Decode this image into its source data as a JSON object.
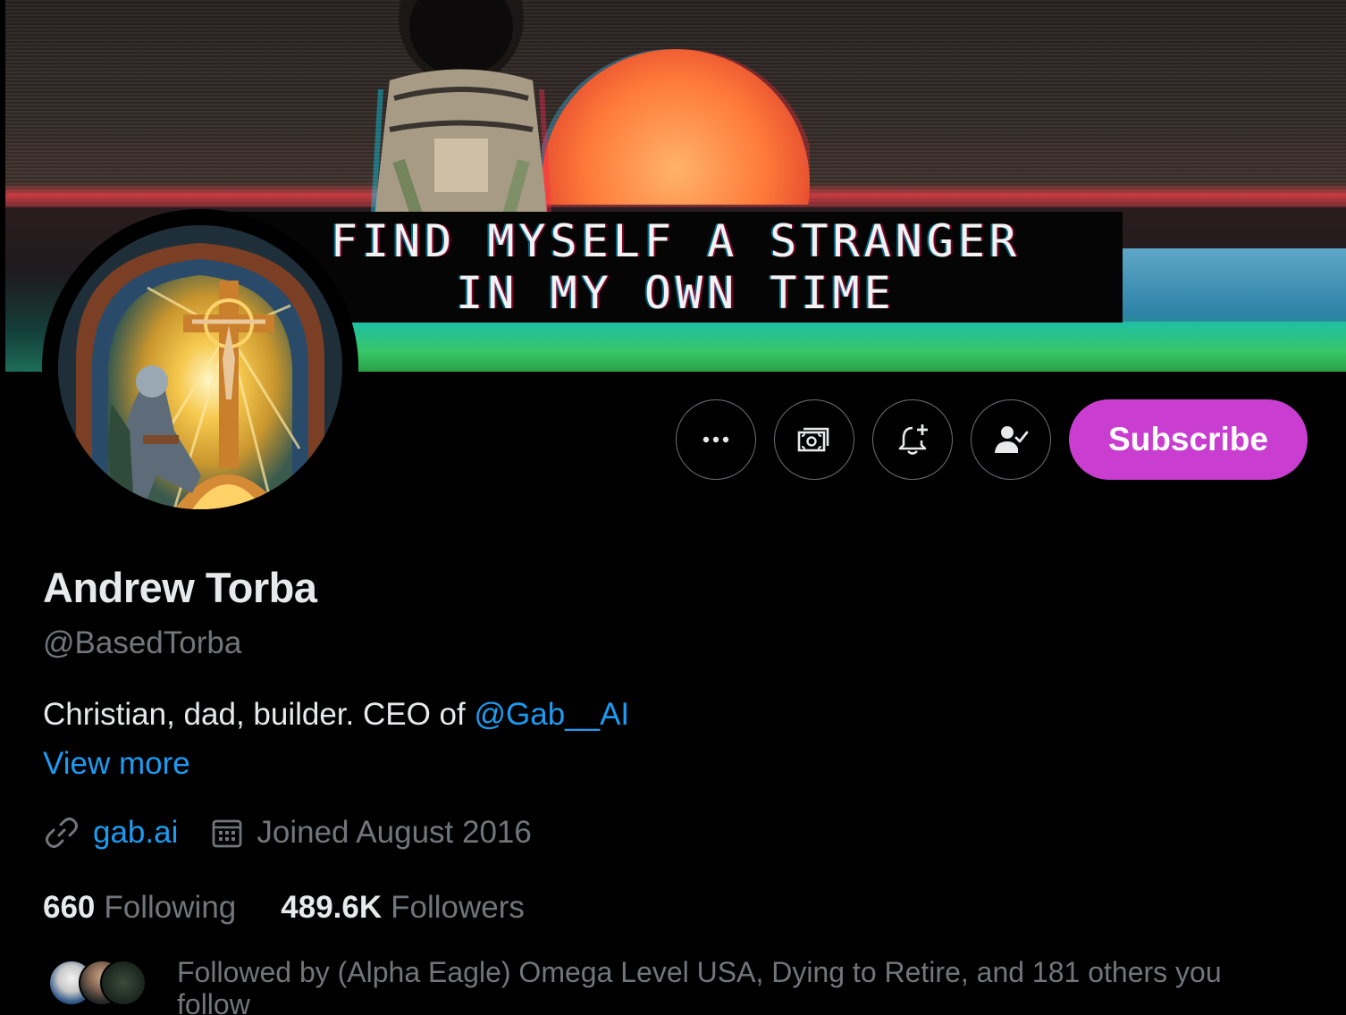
{
  "banner": {
    "caption_line1": "FIND MYSELF A STRANGER",
    "caption_line2": "IN MY OWN TIME"
  },
  "actions": {
    "more_icon": "more-icon",
    "tip_icon": "money-icon",
    "notify_icon": "bell-plus-icon",
    "following_icon": "person-check-icon",
    "subscribe_label": "Subscribe"
  },
  "profile": {
    "name": "Andrew Torba",
    "handle": "@BasedTorba",
    "bio_text": "Christian, dad, builder. CEO of ",
    "bio_mention": "@Gab__AI",
    "view_more": "View more",
    "website": "gab.ai",
    "joined": "Joined August 2016"
  },
  "stats": {
    "following_count": "660",
    "following_label": "Following",
    "followers_count": "489.6K",
    "followers_label": "Followers"
  },
  "followed_by": {
    "text": "Followed by (Alpha Eagle) Omega Level USA, Dying to Retire, and 181 others you follow"
  },
  "colors": {
    "accent_link": "#1d9bf0",
    "subscribe_bg": "#c93ed0",
    "muted_text": "#71767b",
    "background": "#000000"
  }
}
